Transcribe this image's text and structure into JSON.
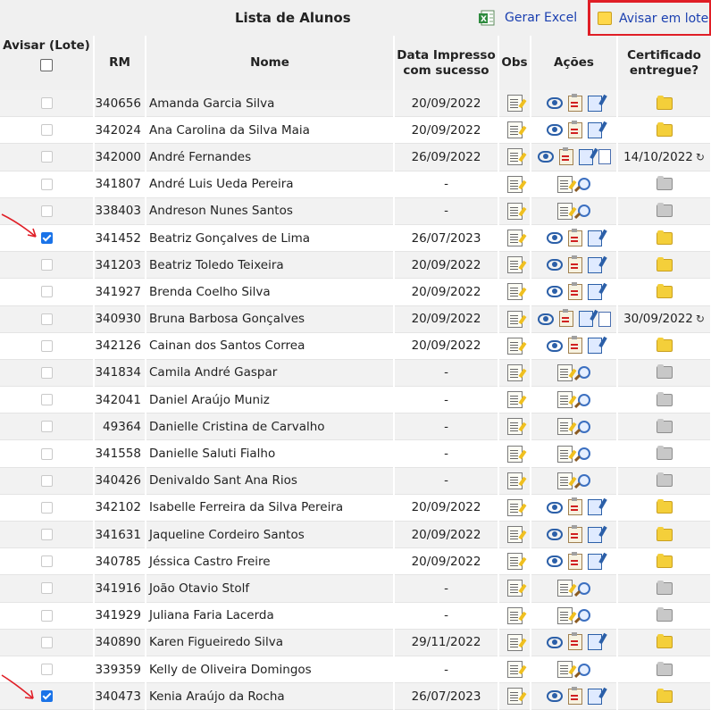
{
  "header": {
    "title": "Lista de Alunos",
    "excel_label": "Gerar Excel",
    "lote_label": "Avisar em lote"
  },
  "columns": {
    "avisar": "Avisar (Lote)",
    "rm": "RM",
    "nome": "Nome",
    "data": "Data Impresso com sucesso",
    "obs": "Obs",
    "acoes": "Ações",
    "cert": "Certificado entregue?"
  },
  "rows": [
    {
      "rm": "340656",
      "nome": "Amanda Garcia Silva",
      "data": "20/09/2022",
      "checked": false,
      "acoes": "std",
      "cert": "folder-yellow",
      "cert_date": ""
    },
    {
      "rm": "342024",
      "nome": "Ana Carolina da Silva Maia",
      "data": "20/09/2022",
      "checked": false,
      "acoes": "std",
      "cert": "folder-yellow",
      "cert_date": ""
    },
    {
      "rm": "342000",
      "nome": "André Fernandes",
      "data": "26/09/2022",
      "checked": false,
      "acoes": "ext",
      "cert": "date",
      "cert_date": "14/10/2022"
    },
    {
      "rm": "341807",
      "nome": "André Luis Ueda Pereira",
      "data": "-",
      "checked": false,
      "acoes": "min",
      "cert": "folder-gray",
      "cert_date": ""
    },
    {
      "rm": "338403",
      "nome": "Andreson Nunes Santos",
      "data": "-",
      "checked": false,
      "acoes": "min",
      "cert": "folder-gray",
      "cert_date": ""
    },
    {
      "rm": "341452",
      "nome": "Beatriz Gonçalves de Lima",
      "data": "26/07/2023",
      "checked": true,
      "acoes": "std",
      "cert": "folder-yellow",
      "cert_date": ""
    },
    {
      "rm": "341203",
      "nome": "Beatriz Toledo Teixeira",
      "data": "20/09/2022",
      "checked": false,
      "acoes": "std",
      "cert": "folder-yellow",
      "cert_date": ""
    },
    {
      "rm": "341927",
      "nome": "Brenda Coelho Silva",
      "data": "20/09/2022",
      "checked": false,
      "acoes": "std",
      "cert": "folder-yellow",
      "cert_date": ""
    },
    {
      "rm": "340930",
      "nome": "Bruna Barbosa Gonçalves",
      "data": "20/09/2022",
      "checked": false,
      "acoes": "ext",
      "cert": "date",
      "cert_date": "30/09/2022"
    },
    {
      "rm": "342126",
      "nome": "Cainan dos Santos Correa",
      "data": "20/09/2022",
      "checked": false,
      "acoes": "std",
      "cert": "folder-yellow",
      "cert_date": ""
    },
    {
      "rm": "341834",
      "nome": "Camila André Gaspar",
      "data": "-",
      "checked": false,
      "acoes": "min",
      "cert": "folder-gray",
      "cert_date": ""
    },
    {
      "rm": "342041",
      "nome": "Daniel Araújo Muniz",
      "data": "-",
      "checked": false,
      "acoes": "min",
      "cert": "folder-gray",
      "cert_date": ""
    },
    {
      "rm": "49364",
      "nome": "Danielle Cristina de Carvalho",
      "data": "-",
      "checked": false,
      "acoes": "min",
      "cert": "folder-gray",
      "cert_date": ""
    },
    {
      "rm": "341558",
      "nome": "Danielle Saluti Fialho",
      "data": "-",
      "checked": false,
      "acoes": "min",
      "cert": "folder-gray",
      "cert_date": ""
    },
    {
      "rm": "340426",
      "nome": "Denivaldo Sant Ana Rios",
      "data": "-",
      "checked": false,
      "acoes": "min",
      "cert": "folder-gray",
      "cert_date": ""
    },
    {
      "rm": "342102",
      "nome": "Isabelle Ferreira da Silva Pereira",
      "data": "20/09/2022",
      "checked": false,
      "acoes": "std",
      "cert": "folder-yellow",
      "cert_date": ""
    },
    {
      "rm": "341631",
      "nome": "Jaqueline Cordeiro Santos",
      "data": "20/09/2022",
      "checked": false,
      "acoes": "std",
      "cert": "folder-yellow",
      "cert_date": ""
    },
    {
      "rm": "340785",
      "nome": "Jéssica Castro Freire",
      "data": "20/09/2022",
      "checked": false,
      "acoes": "std",
      "cert": "folder-yellow",
      "cert_date": ""
    },
    {
      "rm": "341916",
      "nome": "João Otavio Stolf",
      "data": "-",
      "checked": false,
      "acoes": "min",
      "cert": "folder-gray",
      "cert_date": ""
    },
    {
      "rm": "341929",
      "nome": "Juliana Faria Lacerda",
      "data": "-",
      "checked": false,
      "acoes": "min",
      "cert": "folder-gray",
      "cert_date": ""
    },
    {
      "rm": "340890",
      "nome": "Karen Figueiredo Silva",
      "data": "29/11/2022",
      "checked": false,
      "acoes": "std",
      "cert": "folder-yellow",
      "cert_date": ""
    },
    {
      "rm": "339359",
      "nome": "Kelly de Oliveira Domingos",
      "data": "-",
      "checked": false,
      "acoes": "min",
      "cert": "folder-gray",
      "cert_date": ""
    },
    {
      "rm": "340473",
      "nome": "Kenia Araújo da Rocha",
      "data": "26/07/2023",
      "checked": true,
      "acoes": "std",
      "cert": "folder-yellow",
      "cert_date": ""
    }
  ],
  "colors": {
    "link": "#1a3fb0",
    "highlight_border": "#e01e26",
    "arrow": "#e01e26"
  }
}
